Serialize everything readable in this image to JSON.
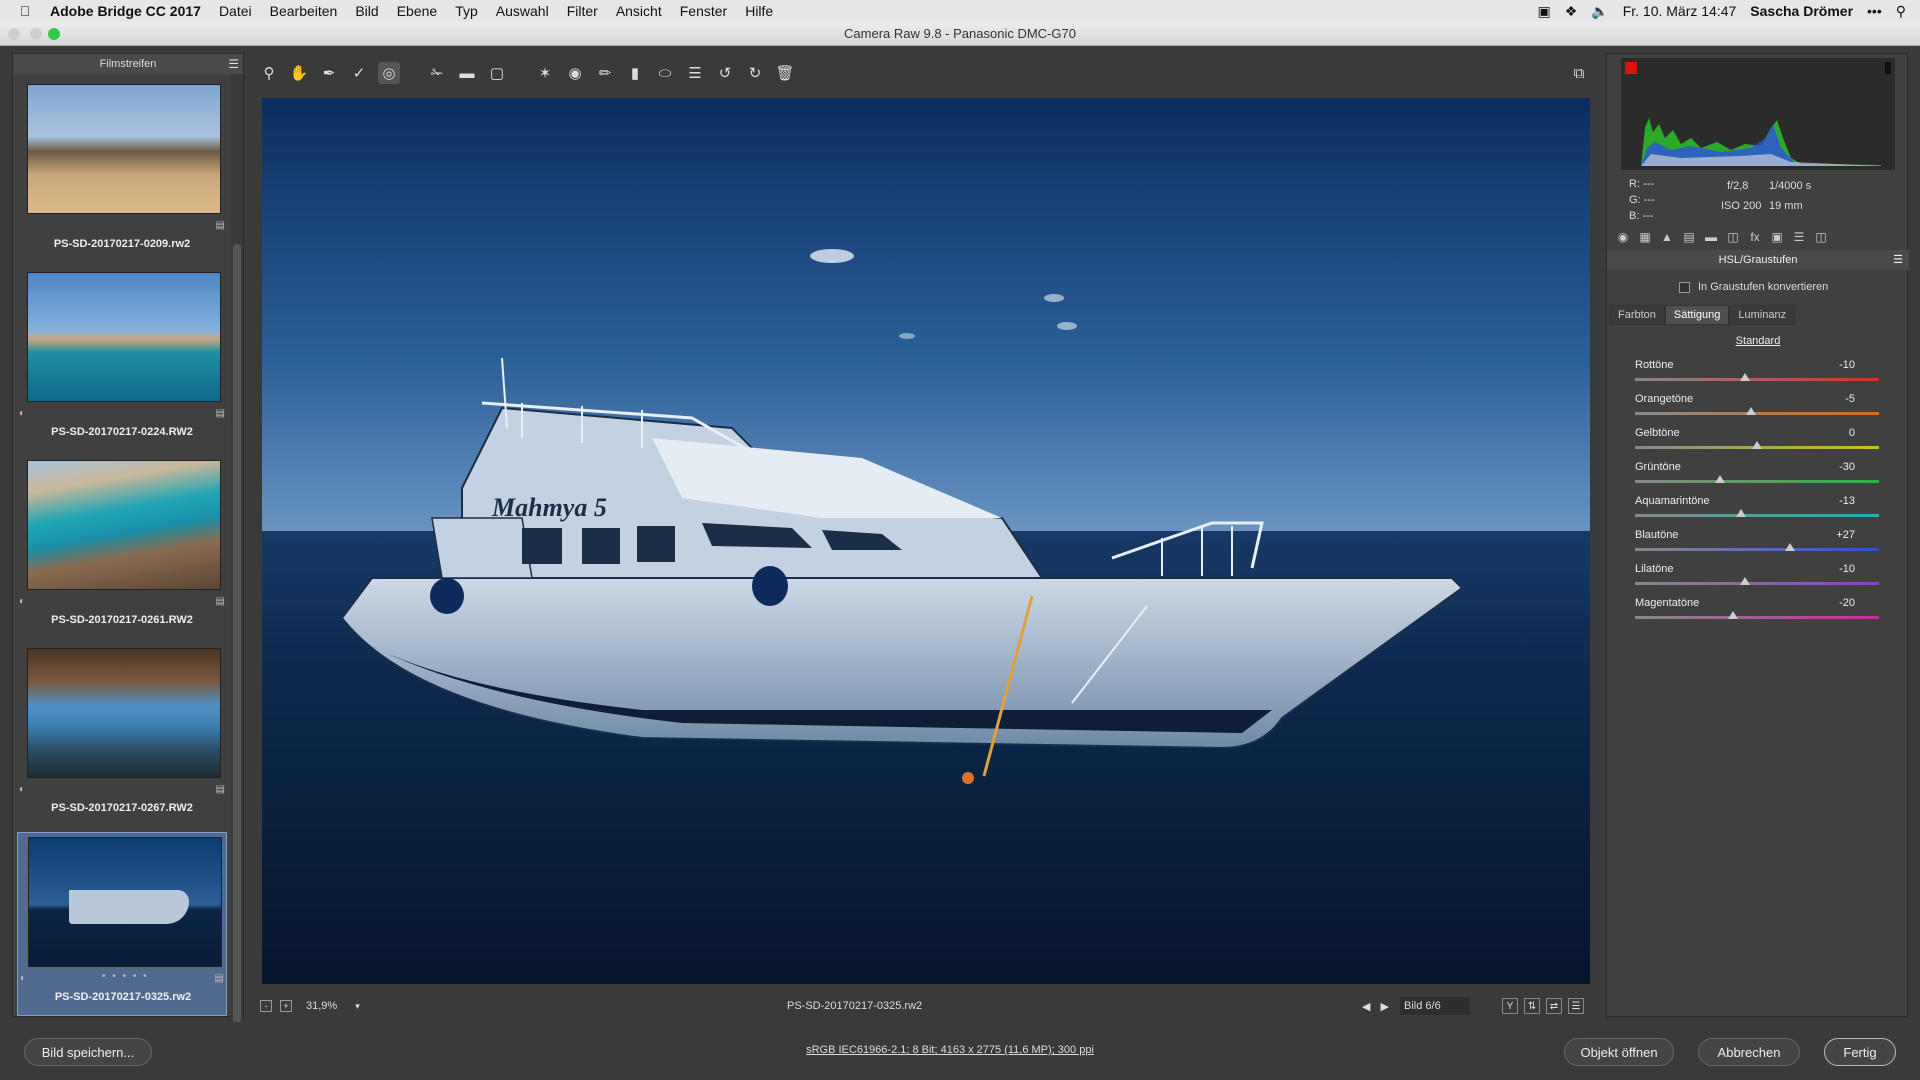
{
  "menubar": {
    "app": "Adobe Bridge CC 2017",
    "items": [
      "Datei",
      "Bearbeiten",
      "Bild",
      "Ebene",
      "Typ",
      "Auswahl",
      "Filter",
      "Ansicht",
      "Fenster",
      "Hilfe"
    ],
    "datetime": "Fr. 10. März 14:47",
    "user": "Sascha Drömer"
  },
  "window": {
    "title": "Camera Raw 9.8  -  Panasonic DMC-G70"
  },
  "filmstrip": {
    "title": "Filmstreifen",
    "items": [
      {
        "name": "PS-SD-20170217-0209.rw2"
      },
      {
        "name": "PS-SD-20170217-0224.RW2"
      },
      {
        "name": "PS-SD-20170217-0261.RW2"
      },
      {
        "name": "PS-SD-20170217-0267.RW2"
      },
      {
        "name": "PS-SD-20170217-0325.rw2"
      }
    ],
    "rating_dots": "• • • • •"
  },
  "toolbar": {
    "tools": [
      "zoom-tool",
      "hand-tool",
      "white-balance-tool",
      "color-sampler-tool",
      "target-adjustment-tool",
      "crop-tool",
      "straighten-tool",
      "transform-tool",
      "spot-removal-tool",
      "red-eye-tool",
      "adjustment-brush",
      "graduated-filter",
      "radial-filter",
      "preferences",
      "rotate-left",
      "rotate-right",
      "delete"
    ]
  },
  "preview": {
    "boat_name": "Mahmya 5"
  },
  "status": {
    "zoom": "31,9%",
    "filename": "PS-SD-20170217-0325.rw2",
    "image_counter": "Bild 6/6"
  },
  "info": {
    "r": "R:   ---",
    "g": "G:   ---",
    "b": "B:   ---",
    "aperture": "f/2,8",
    "shutter": "1/4000 s",
    "iso": "ISO 200",
    "focal": "19 mm"
  },
  "panel": {
    "title": "HSL/Graustufen",
    "grayscale_label": "In Graustufen konvertieren",
    "tabs": [
      "Farbton",
      "Sättigung",
      "Luminanz"
    ],
    "active_tab": "Sättigung",
    "standard": "Standard",
    "sliders": [
      {
        "label": "Rottöne",
        "value": "-10",
        "num": -10,
        "color": "#d03030"
      },
      {
        "label": "Orangetöne",
        "value": "-5",
        "num": -5,
        "color": "#d07020"
      },
      {
        "label": "Gelbtöne",
        "value": "0",
        "num": 0,
        "color": "#c8c020"
      },
      {
        "label": "Grüntöne",
        "value": "-30",
        "num": -30,
        "color": "#30b040"
      },
      {
        "label": "Aquamarintöne",
        "value": "-13",
        "num": -13,
        "color": "#20b0b0"
      },
      {
        "label": "Blautöne",
        "value": "+27",
        "num": 27,
        "color": "#3050d0"
      },
      {
        "label": "Lilatöne",
        "value": "-10",
        "num": -10,
        "color": "#9040c0"
      },
      {
        "label": "Magentatöne",
        "value": "-20",
        "num": -20,
        "color": "#c030a0"
      }
    ]
  },
  "bottom": {
    "save": "Bild speichern...",
    "meta": "sRGB IEC61966-2.1; 8 Bit; 4163 x 2775 (11,6 MP); 300 ppi",
    "open": "Objekt öffnen",
    "cancel": "Abbrechen",
    "done": "Fertig"
  }
}
